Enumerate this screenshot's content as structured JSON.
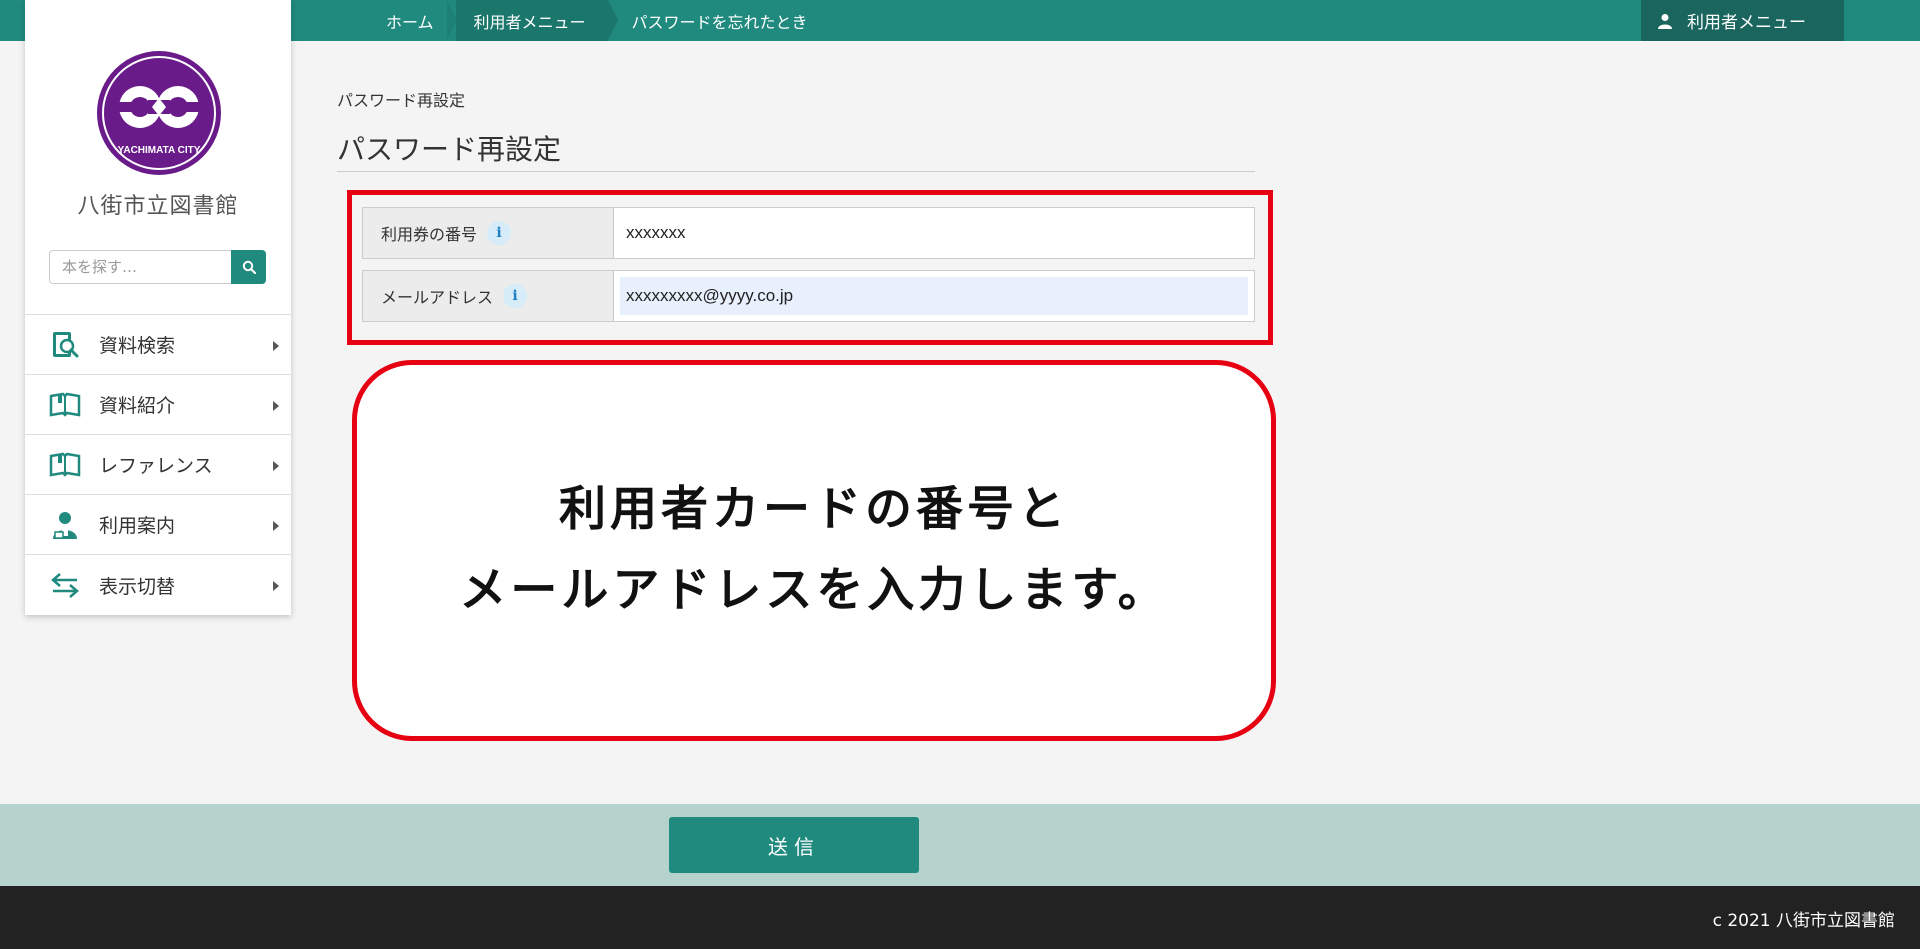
{
  "breadcrumb": {
    "items": [
      "ホーム",
      "利用者メニュー",
      "パスワードを忘れたとき"
    ]
  },
  "header": {
    "user_menu_label": "利用者メニュー"
  },
  "sidebar": {
    "logo_text": "YACHIMATA CITY",
    "library_name": "八街市立図書館",
    "search_placeholder": "本を探す…",
    "items": [
      {
        "label": "資料検索",
        "icon": "book-search-icon"
      },
      {
        "label": "資料紹介",
        "icon": "open-book-icon"
      },
      {
        "label": "レファレンス",
        "icon": "open-book-icon"
      },
      {
        "label": "利用案内",
        "icon": "librarian-icon"
      },
      {
        "label": "表示切替",
        "icon": "switch-arrows-icon"
      }
    ]
  },
  "main": {
    "subtitle": "パスワード再設定",
    "title": "パスワード再設定",
    "form": {
      "card_number_label": "利用券の番号",
      "card_number_value": "xxxxxxx",
      "email_label": "メールアドレス",
      "email_value": "xxxxxxxxx@yyyy.co.jp",
      "info_glyph": "i"
    },
    "callout": {
      "line1": "利用者カードの番号と",
      "line2": "メールアドレスを入力します。"
    },
    "submit_label": "送信"
  },
  "footer": {
    "copyright": "c 2021 八街市立図書館"
  },
  "colors": {
    "brand_teal": "#208a7f",
    "highlight_red": "#e60012",
    "logo_purple": "#6a1b8a"
  }
}
